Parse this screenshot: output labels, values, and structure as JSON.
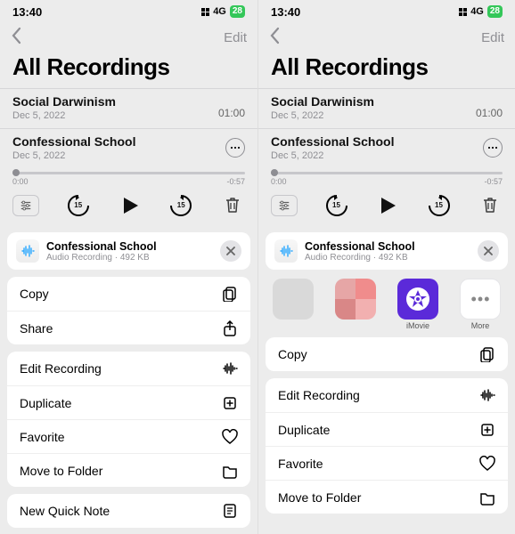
{
  "status": {
    "time": "13:40",
    "net": "4G",
    "batt": "28"
  },
  "nav": {
    "edit": "Edit"
  },
  "title": "All Recordings",
  "recordings": [
    {
      "name": "Social Darwinism",
      "date": "Dec 5, 2022",
      "duration": "01:00"
    },
    {
      "name": "Confessional School",
      "date": "Dec 5, 2022"
    }
  ],
  "scrub": {
    "start": "0:00",
    "end": "-0:57"
  },
  "skip": "15",
  "sheet": {
    "title": "Confessional School",
    "sub": "Audio Recording · 492 KB"
  },
  "menuLeft": {
    "g1": [
      {
        "label": "Copy",
        "icon": "copy"
      },
      {
        "label": "Share",
        "icon": "share"
      }
    ],
    "g2": [
      {
        "label": "Edit Recording",
        "icon": "wave"
      },
      {
        "label": "Duplicate",
        "icon": "dup"
      },
      {
        "label": "Favorite",
        "icon": "heart"
      },
      {
        "label": "Move to Folder",
        "icon": "folder"
      }
    ],
    "g3": [
      {
        "label": "New Quick Note",
        "icon": "note"
      }
    ]
  },
  "share": {
    "imovie": "iMovie",
    "more": "More"
  },
  "menuRight": {
    "g1": [
      {
        "label": "Copy",
        "icon": "copy"
      }
    ],
    "g2": [
      {
        "label": "Edit Recording",
        "icon": "wave"
      },
      {
        "label": "Duplicate",
        "icon": "dup"
      },
      {
        "label": "Favorite",
        "icon": "heart"
      },
      {
        "label": "Move to Folder",
        "icon": "folder"
      }
    ]
  }
}
